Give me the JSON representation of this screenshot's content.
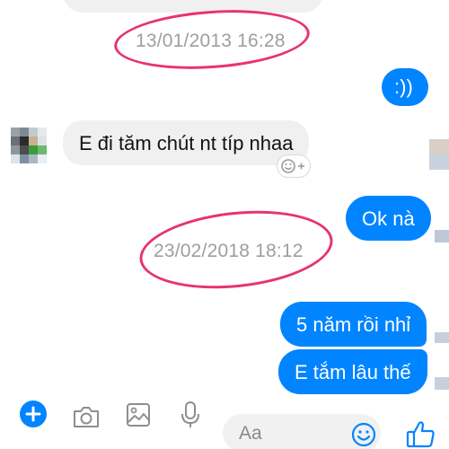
{
  "conversation": {
    "timestamps": [
      {
        "id": "ts1",
        "text": "13/01/2013 16:28"
      },
      {
        "id": "ts2",
        "text": "23/02/2018 18:12"
      }
    ],
    "messages": [
      {
        "id": "m1",
        "direction": "outgoing",
        "text": ":))"
      },
      {
        "id": "m2",
        "direction": "incoming",
        "text": "E đi tăm chút nt típ nhaa"
      },
      {
        "id": "m3",
        "direction": "outgoing",
        "text": "Ok nà"
      },
      {
        "id": "m4",
        "direction": "outgoing",
        "text": "5 năm rồi nhỉ"
      },
      {
        "id": "m5",
        "direction": "outgoing",
        "text": "E tắm lâu thế"
      }
    ]
  },
  "composer": {
    "placeholder": "Aa",
    "icons": [
      "plus-icon",
      "camera-icon",
      "gallery-icon",
      "microphone-icon",
      "emoji-icon",
      "thumbs-up-icon"
    ]
  },
  "colors": {
    "outgoing_bubble": "#0084ff",
    "incoming_bubble": "#f0f0f0",
    "timestamp_text": "#9e9e9e",
    "annotation_circle": "#e8336d",
    "accent": "#0084ff"
  }
}
